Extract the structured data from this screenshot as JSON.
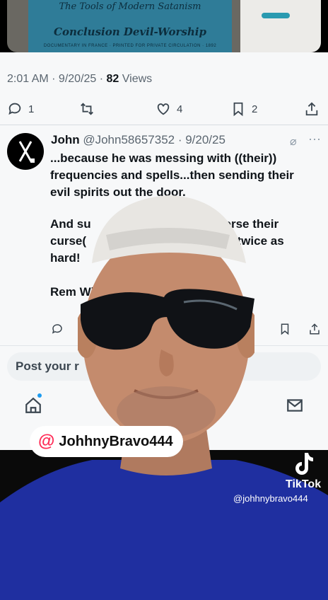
{
  "post_image": {
    "title_line1": "The Tools of Modern Satanism",
    "title_line2": "Conclusion Devil-Worship",
    "footer": "DOCUMENTARY IN FRANCE · PRINTED FOR PRIVATE CIRCULATION · 1892"
  },
  "post_meta": {
    "time": "2:01 AM",
    "date": "9/20/25",
    "views_count": "82",
    "views_label": "Views"
  },
  "actions": {
    "replies": "1",
    "likes": "4",
    "bookmarks": "2"
  },
  "reply": {
    "name": "John",
    "handle": "@John58657352",
    "date": "9/20/25",
    "paragraph1": "...because he was messing with ((their)) frequencies and spells...then sending their evil spirits out the door.",
    "paragraph2": "And su                                        erse their curse(                                         m twice as hard!",
    "paragraph3": "Rem Wit"
  },
  "compose": {
    "placeholder": "Post your r"
  },
  "overlay": {
    "mention_at": "@",
    "mention_name": "JohhnyBravo444",
    "tiktok_label": "TikTok",
    "tiktok_handle": "@johhnybravo444"
  },
  "colors": {
    "accent_pink": "#ff2a55",
    "shirt_blue": "#1f2fa0",
    "book_teal": "#2f7c98"
  }
}
